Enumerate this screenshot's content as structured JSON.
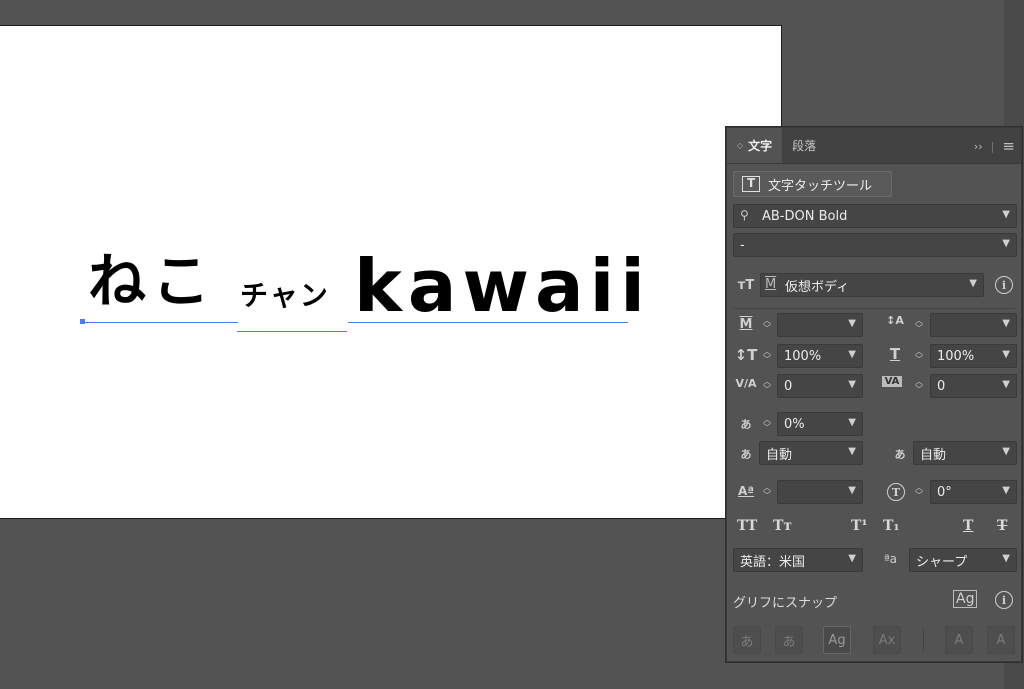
{
  "artboard": {
    "text_neko": "ねこ",
    "text_chan": "チャン",
    "text_kawaii": "kawaii"
  },
  "panel": {
    "tabs": [
      {
        "label": "文字",
        "active": true
      },
      {
        "label": "段落",
        "active": false
      }
    ],
    "collapse_glyph": "››",
    "menu_glyph": "≡",
    "touch_tool_label": "文字タッチツール",
    "font_search_icon": "search-icon",
    "font_family": "AB-DON Bold",
    "font_style": "-",
    "font_size_label": "仮想ボディ",
    "font_size_prefix": "M",
    "kerning": "",
    "leading": "",
    "vertical_scale": "100%",
    "horizontal_scale": "100%",
    "tracking": "0",
    "baseline_kerning": "0",
    "tsume": "0%",
    "aki_left": "自動",
    "aki_right": "自動",
    "baseline_shift": "",
    "rotation": "0°",
    "language": "英語：米国",
    "antialias_prefix": "ªa",
    "antialias": "シャープ",
    "snap_label": "グリフにスナップ",
    "format_buttons": [
      "TT",
      "Tт",
      "T¹",
      "T₁",
      "T",
      "T"
    ],
    "bottom_buttons": [
      "あ",
      "あ",
      "Ag",
      "Ax",
      "A",
      "A"
    ],
    "accent": "#4a7dff"
  }
}
